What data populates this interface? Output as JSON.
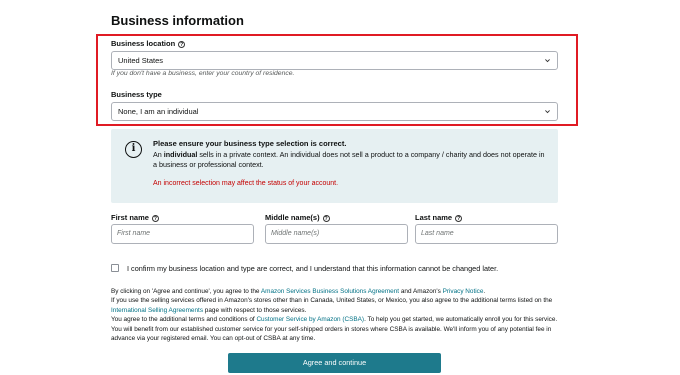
{
  "page": {
    "title": "Business information"
  },
  "business_location": {
    "label": "Business location",
    "value": "United States",
    "hint": "If you don't have a business, enter your country of residence."
  },
  "business_type": {
    "label": "Business type",
    "value": "None, I am an individual"
  },
  "notice": {
    "title": "Please ensure your business type selection is correct.",
    "body_prefix": "An ",
    "body_bold": "individual",
    "body_rest": " sells in a private context. An individual does not sell a product to a company / charity and does not operate in a business or professional context.",
    "warning": "An incorrect selection may affect the status of your account."
  },
  "name_fields": [
    {
      "label": "First name",
      "placeholder": "First name"
    },
    {
      "label": "Middle name(s)",
      "placeholder": "Middle name(s)"
    },
    {
      "label": "Last name",
      "placeholder": "Last name"
    }
  ],
  "confirm": {
    "label": "I confirm my business location and type are correct, and I understand that this information cannot be changed later."
  },
  "legal": {
    "p1_a": "By clicking on 'Agree and continue', you agree to the ",
    "link_bsa": "Amazon Services Business Solutions Agreement",
    "p1_b": " and Amazon's ",
    "link_privacy": "Privacy Notice",
    "p1_c": ".",
    "p2_a": "If you use the selling services offered in Amazon's stores other than in Canada, United States, or Mexico, you also agree to the additional terms listed on the ",
    "link_isa": "International Selling Agreements",
    "p2_b": " page with respect to those services.",
    "p3_a": "You agree to the additional terms and conditions of ",
    "link_csba": "Customer Service by Amazon (CSBA)",
    "p3_b": ". To help you get started, we automatically enroll you for this service. You will benefit from our established customer service for your self-shipped orders in stores where CSBA is available. We'll inform you of any potential fee in advance via your registered email. You can opt-out of CSBA at any time."
  },
  "actions": {
    "agree_label": "Agree and continue"
  },
  "icons": {
    "help": "question-circle-icon",
    "info": "info-circle-icon",
    "dropdown": "chevron-down-icon"
  },
  "colors": {
    "highlight_border": "#e01b24",
    "notice_bg": "#e6f0f2",
    "warning_text": "#c40000",
    "link": "#007185",
    "button_bg": "#1e7a8c"
  }
}
